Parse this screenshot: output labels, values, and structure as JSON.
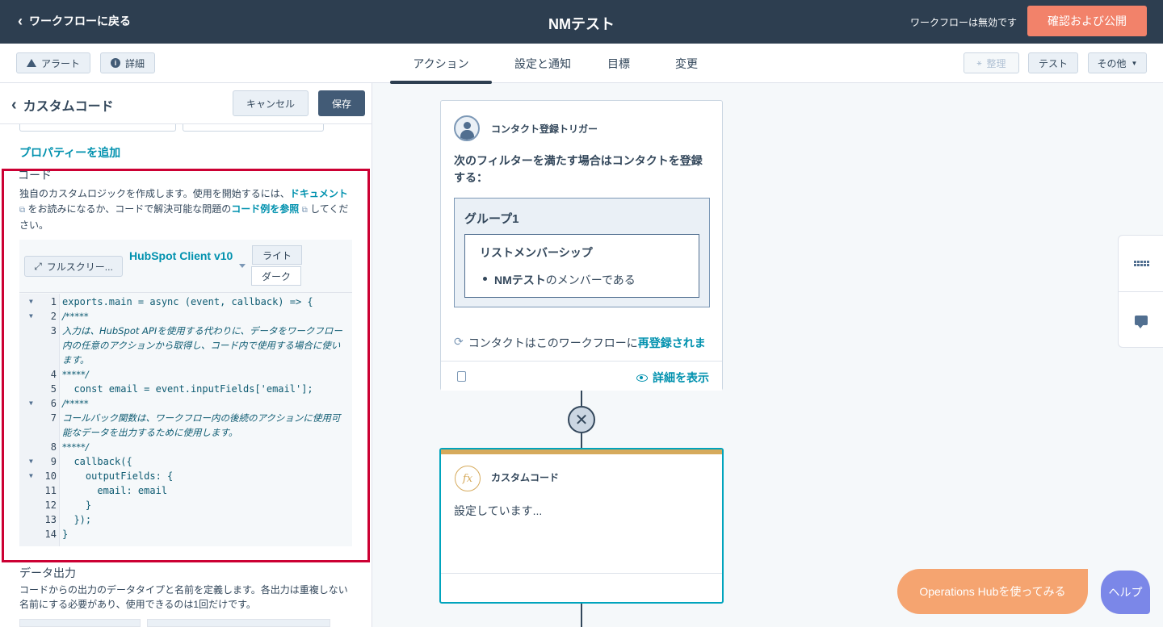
{
  "topbar": {
    "back_label": "ワークフローに戻る",
    "title": "NMテスト",
    "status": "ワークフローは無効です",
    "publish_label": "確認および公開"
  },
  "subbar": {
    "alert_label": "アラート",
    "details_label": "詳細",
    "tabs": [
      "アクション",
      "設定と通知",
      "目標",
      "変更"
    ],
    "organize_label": "整理",
    "test_label": "テスト",
    "more_label": "その他"
  },
  "panel": {
    "title": "カスタムコード",
    "cancel_label": "キャンセル",
    "save_label": "保存",
    "add_property": "プロパティーを追加",
    "code_heading": "コード",
    "code_desc_1": "独自のカスタムロジックを作成します。使用を開始するには、",
    "doc_link": "ドキュメント",
    "code_desc_2": "をお読みになるか、コードで解決可能な問題の",
    "example_link": "コード例を参照",
    "code_desc_3": "してください。",
    "fullscreen_label": "フルスクリー...",
    "client_label": "HubSpot Client v10",
    "theme_light": "ライト",
    "theme_dark": "ダーク",
    "data_out_heading": "データ出力",
    "data_out_desc": "コードからの出力のデータタイプと名前を定義します。各出力は重複しない名前にする必要があり、使用できるのは1回だけです。"
  },
  "code": {
    "l1": "exports.main = async (event, callback) => {",
    "l2": "  /*****",
    "l3": "    入力は、HubSpot APIを使用する代わりに、データをワークフロー内の任意のアクションから取得し、コード内で使用する場合に使います。",
    "l4": "  *****/",
    "l5": "  const email = event.inputFields['email'];",
    "l6": "  /*****",
    "l7": "    コールバック関数は、ワークフロー内の後続のアクションに使用可能なデータを出力するために使用します。",
    "l8": "  *****/",
    "l9": "  callback({",
    "l10": "    outputFields: {",
    "l11": "      email: email",
    "l12": "    }",
    "l13": "  });",
    "l14": "}"
  },
  "canvas": {
    "trigger_label": "コンタクト登録トリガー",
    "trigger_text": "次のフィルターを満たす場合はコンタクトを登録する：",
    "group_title": "グループ1",
    "filter_title": "リストメンバーシップ",
    "filter_bold": "NMテスト",
    "filter_rest": "のメンバーである",
    "reenroll_prefix": "コンタクトはこのワークフローに",
    "reenroll_link": "再登録されま",
    "view_details": "詳細を表示",
    "action_label": "カスタムコード",
    "action_status": "設定しています..."
  },
  "floating": {
    "ops_label": "Operations Hubを使ってみる",
    "help_label": "ヘルプ"
  }
}
